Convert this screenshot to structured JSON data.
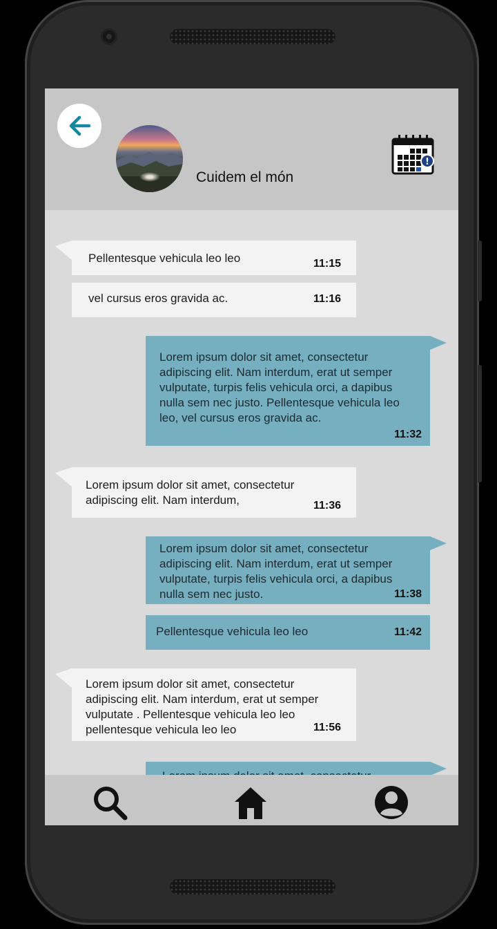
{
  "header": {
    "title": "Cuidem el món",
    "back_icon": "arrow-left-icon",
    "calendar_icon": "calendar-alert-icon",
    "calendar_badge": "!"
  },
  "messages": [
    {
      "side": "in",
      "text": "Pellentesque vehicula leo leo",
      "time": "11:15"
    },
    {
      "side": "in",
      "text": "vel cursus eros gravida ac.",
      "time": "11:16"
    },
    {
      "side": "out",
      "text": "Lorem ipsum dolor sit amet, consectetur adipiscing elit. Nam interdum, erat ut semper vulputate, turpis felis vehicula orci, a dapibus nulla sem nec justo. Pellentesque vehicula leo leo, vel cursus eros gravida ac.",
      "time": "11:32"
    },
    {
      "side": "in",
      "text": "Lorem ipsum dolor sit amet, consectetur adipiscing elit. Nam interdum,",
      "time": "11:36"
    },
    {
      "side": "out",
      "text": "Lorem ipsum dolor sit amet, consectetur adipiscing elit. Nam interdum, erat ut semper vulputate, turpis felis vehicula orci, a dapibus nulla sem nec justo.",
      "time": "11:38"
    },
    {
      "side": "out",
      "text": "Pellentesque vehicula leo leo",
      "time": "11:42"
    },
    {
      "side": "in",
      "text": "Lorem ipsum dolor sit amet, consectetur adipiscing elit. Nam interdum, erat ut semper vulputate . Pellentesque vehicula leo leo pellentesque vehicula leo leo",
      "time": "11:56"
    },
    {
      "side": "out",
      "text": "Lorem ipsum dolor sit amet, consectetur",
      "time": ""
    }
  ],
  "navbar": {
    "items": [
      {
        "icon": "search-icon"
      },
      {
        "icon": "home-icon"
      },
      {
        "icon": "profile-icon"
      }
    ]
  },
  "colors": {
    "accent": "#138aa0",
    "outgoing_bubble": "#75afc0",
    "incoming_bubble": "#f3f3f3",
    "header_bg": "#c6c6c6",
    "chat_bg": "#dadada"
  }
}
